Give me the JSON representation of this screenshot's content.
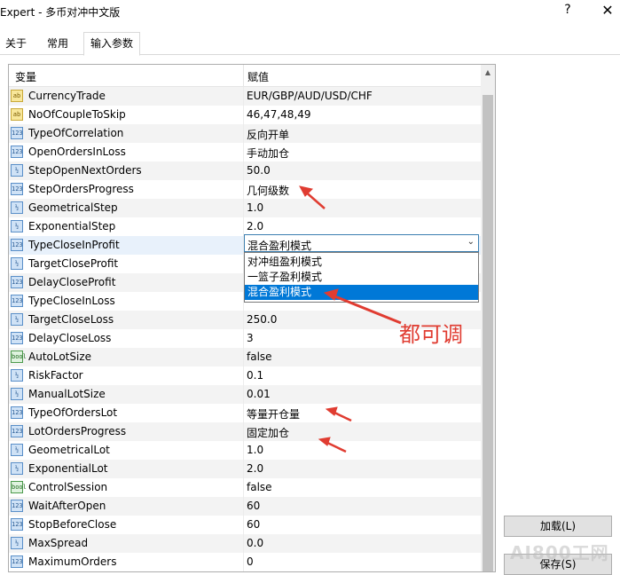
{
  "window": {
    "title": "Expert - 多币对冲中文版",
    "help_label": "?",
    "close_label": "✕"
  },
  "tabs": [
    {
      "label": "关于"
    },
    {
      "label": "常用"
    },
    {
      "label": "输入参数"
    }
  ],
  "grid": {
    "col_variable": "变量",
    "col_value": "赋值"
  },
  "params": [
    {
      "name": "CurrencyTrade",
      "value": "EUR/GBP/AUD/USD/CHF",
      "icon": "ab"
    },
    {
      "name": "NoOfCoupleToSkip",
      "value": "46,47,48,49",
      "icon": "ab"
    },
    {
      "name": "TypeOfCorrelation",
      "value": "反向开单",
      "icon": "123"
    },
    {
      "name": "OpenOrdersInLoss",
      "value": "手动加仓",
      "icon": "123"
    },
    {
      "name": "StepOpenNextOrders",
      "value": "50.0",
      "icon": "½"
    },
    {
      "name": "StepOrdersProgress",
      "value": "几何级数",
      "icon": "123"
    },
    {
      "name": "GeometricalStep",
      "value": "1.0",
      "icon": "½"
    },
    {
      "name": "ExponentialStep",
      "value": "2.0",
      "icon": "½"
    },
    {
      "name": "TypeCloseInProfit",
      "value": "混合盈利模式",
      "icon": "123"
    },
    {
      "name": "TargetCloseProfit",
      "value": "",
      "icon": "½"
    },
    {
      "name": "DelayCloseProfit",
      "value": "",
      "icon": "123"
    },
    {
      "name": "TypeCloseInLoss",
      "value": "",
      "icon": "123"
    },
    {
      "name": "TargetCloseLoss",
      "value": "250.0",
      "icon": "½"
    },
    {
      "name": "DelayCloseLoss",
      "value": "3",
      "icon": "123"
    },
    {
      "name": "AutoLotSize",
      "value": "false",
      "icon": "bool"
    },
    {
      "name": "RiskFactor",
      "value": "0.1",
      "icon": "½"
    },
    {
      "name": "ManualLotSize",
      "value": "0.01",
      "icon": "½"
    },
    {
      "name": "TypeOfOrdersLot",
      "value": "等量开仓量",
      "icon": "123"
    },
    {
      "name": "LotOrdersProgress",
      "value": "固定加仓",
      "icon": "123"
    },
    {
      "name": "GeometricalLot",
      "value": "1.0",
      "icon": "½"
    },
    {
      "name": "ExponentialLot",
      "value": "2.0",
      "icon": "½"
    },
    {
      "name": "ControlSession",
      "value": "false",
      "icon": "bool"
    },
    {
      "name": "WaitAfterOpen",
      "value": "60",
      "icon": "123"
    },
    {
      "name": "StopBeforeClose",
      "value": "60",
      "icon": "123"
    },
    {
      "name": "MaxSpread",
      "value": "0.0",
      "icon": "½"
    },
    {
      "name": "MaximumOrders",
      "value": "0",
      "icon": "123"
    }
  ],
  "combo": {
    "value": "混合盈利模式",
    "options": [
      "对冲组盈利模式",
      "一篮子盈利模式",
      "混合盈利模式"
    ],
    "selected_index": 2,
    "arrow_icon": "chevron-down-icon"
  },
  "buttons": {
    "load": "加载(L)",
    "save": "保存(S)"
  },
  "annotation": {
    "text": "都可调",
    "color": "#e03c31"
  },
  "watermark": {
    "text": "AI800工网"
  },
  "colors": {
    "selection": "#0078d7",
    "alt_row": "#f3f3f3",
    "highlight_row": "#e8f1fb"
  }
}
